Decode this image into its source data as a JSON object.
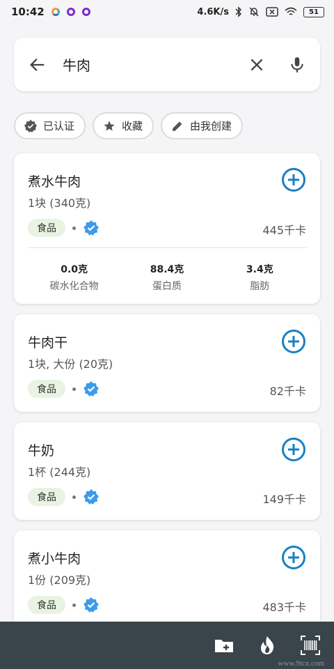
{
  "status_bar": {
    "time": "10:42",
    "network_speed": "4.6K/s",
    "battery": "51",
    "icons": [
      "app-dot-icon",
      "bluetooth-icon",
      "mute-icon",
      "sim-icon",
      "wifi-icon",
      "battery-icon"
    ]
  },
  "search": {
    "query": "牛肉"
  },
  "filters": [
    {
      "label": "已认证",
      "icon": "verified-check-icon"
    },
    {
      "label": "收藏",
      "icon": "star-icon"
    },
    {
      "label": "由我创建",
      "icon": "pencil-icon"
    }
  ],
  "results": [
    {
      "name": "煮水牛肉",
      "serving": "1块 (340克)",
      "tag": "食品",
      "kcal": "445千卡",
      "macros": [
        {
          "value": "0.0克",
          "label": "碳水化合物"
        },
        {
          "value": "88.4克",
          "label": "蛋白质"
        },
        {
          "value": "3.4克",
          "label": "脂肪"
        }
      ]
    },
    {
      "name": "牛肉干",
      "serving": "1块, 大份 (20克)",
      "tag": "食品",
      "kcal": "82千卡"
    },
    {
      "name": "牛奶",
      "serving": "1杯 (244克)",
      "tag": "食品",
      "kcal": "149千卡"
    },
    {
      "name": "煮小牛肉",
      "serving": "1份 (209克)",
      "tag": "食品",
      "kcal": "483千卡"
    }
  ],
  "bottom_bar": {
    "icons": [
      "add-folder-icon",
      "flame-icon",
      "barcode-scan-icon"
    ],
    "watermark": "www.9tcx.com"
  },
  "colors": {
    "accent": "#1a7fc1",
    "verified": "#3d9be9",
    "tag_bg": "#e8f3e2",
    "bottom_bar": "#3a444b"
  }
}
